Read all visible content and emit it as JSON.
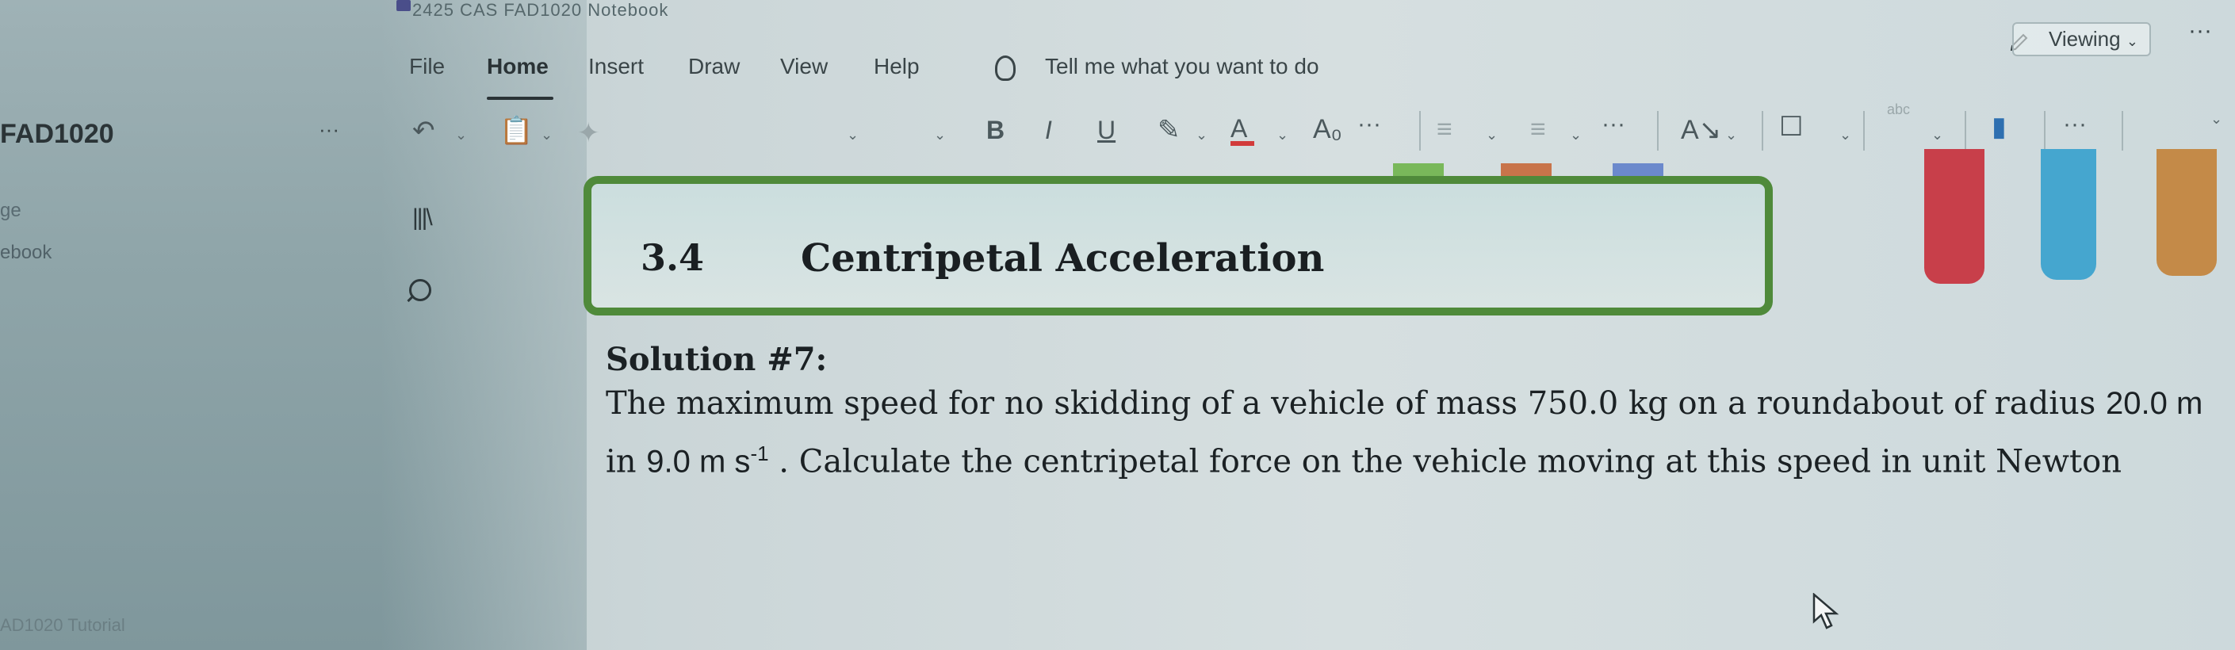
{
  "window": {
    "title": "2425 CAS FAD1020 Notebook"
  },
  "menu": {
    "items": [
      "File",
      "Home",
      "Insert",
      "Draw",
      "View",
      "Help"
    ],
    "active": "Home",
    "tell_me": "Tell me what you want to do",
    "viewing_label": "Viewing",
    "more": "···"
  },
  "ribbon": {
    "bold": "B",
    "italic": "I",
    "underline": "U",
    "more": "···",
    "more2": "···",
    "more3": "···",
    "more4": "···",
    "abc": "abc"
  },
  "sidebar": {
    "notebook_name": "FAD1020",
    "more": "···",
    "section1": "ge",
    "section2": "ebook",
    "bottom_page": "AD1020 Tutorial"
  },
  "page": {
    "heading_number": "3.4",
    "heading_title": "Centripetal Acceleration",
    "solution_title": "Solution #7:",
    "problem_part1": "The maximum speed for no skidding of a vehicle of mass 750.0 kg on a roundabout of radius ",
    "radius": "20.0 m",
    "in_text": " in ",
    "speed": "9.0 m s",
    "speed_exp": "-1",
    "problem_part2": " . Calculate the centripetal force on the vehicle moving at this speed in unit Newton"
  },
  "colors": {
    "heading_border": "#4f8a3a",
    "pen_red": "#c83f4a",
    "pen_blue": "#45a6cf",
    "pen_orange": "#c48a48"
  }
}
